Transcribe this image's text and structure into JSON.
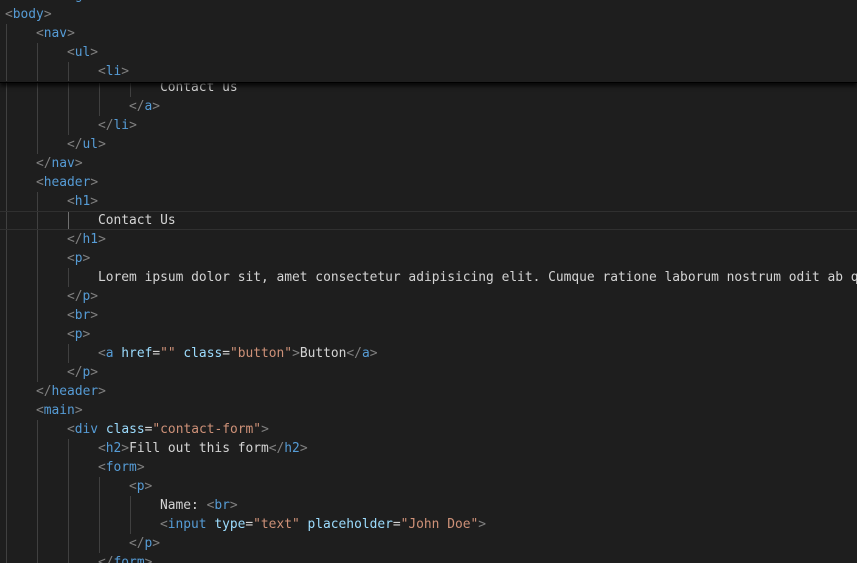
{
  "editor": {
    "sticky_lines": [
      {
        "indent": 0,
        "tokens": [
          {
            "t": "tag",
            "v": "<html lang=\"en\">"
          }
        ]
      },
      {
        "indent": 0,
        "tokens": [
          {
            "t": "brk",
            "v": "<"
          },
          {
            "t": "tag",
            "v": "body"
          },
          {
            "t": "brk",
            "v": ">"
          }
        ]
      },
      {
        "indent": 1,
        "tokens": [
          {
            "t": "brk",
            "v": "<"
          },
          {
            "t": "tag",
            "v": "nav"
          },
          {
            "t": "brk",
            "v": ">"
          }
        ]
      },
      {
        "indent": 2,
        "tokens": [
          {
            "t": "brk",
            "v": "<"
          },
          {
            "t": "tag",
            "v": "ul"
          },
          {
            "t": "brk",
            "v": ">"
          }
        ]
      },
      {
        "indent": 3,
        "tokens": [
          {
            "t": "brk",
            "v": "<"
          },
          {
            "t": "tag",
            "v": "li"
          },
          {
            "t": "brk",
            "v": ">"
          }
        ]
      }
    ],
    "lines": [
      {
        "indent": 5,
        "tokens": [
          {
            "t": "txt",
            "v": "Contact us"
          }
        ]
      },
      {
        "indent": 4,
        "tokens": [
          {
            "t": "brk",
            "v": "</"
          },
          {
            "t": "tag",
            "v": "a"
          },
          {
            "t": "brk",
            "v": ">"
          }
        ]
      },
      {
        "indent": 3,
        "tokens": [
          {
            "t": "brk",
            "v": "</"
          },
          {
            "t": "tag",
            "v": "li"
          },
          {
            "t": "brk",
            "v": ">"
          }
        ]
      },
      {
        "indent": 2,
        "tokens": [
          {
            "t": "brk",
            "v": "</"
          },
          {
            "t": "tag",
            "v": "ul"
          },
          {
            "t": "brk",
            "v": ">"
          }
        ]
      },
      {
        "indent": 1,
        "tokens": [
          {
            "t": "brk",
            "v": "</"
          },
          {
            "t": "tag",
            "v": "nav"
          },
          {
            "t": "brk",
            "v": ">"
          }
        ]
      },
      {
        "indent": 1,
        "tokens": [
          {
            "t": "brk",
            "v": "<"
          },
          {
            "t": "tag",
            "v": "header"
          },
          {
            "t": "brk",
            "v": ">"
          }
        ]
      },
      {
        "indent": 2,
        "tokens": [
          {
            "t": "brk",
            "v": "<"
          },
          {
            "t": "tag",
            "v": "h1"
          },
          {
            "t": "brk",
            "v": ">"
          }
        ]
      },
      {
        "indent": 3,
        "current": true,
        "tokens": [
          {
            "t": "txt",
            "v": "Contact Us"
          }
        ]
      },
      {
        "indent": 2,
        "tokens": [
          {
            "t": "brk",
            "v": "</"
          },
          {
            "t": "tag",
            "v": "h1"
          },
          {
            "t": "brk",
            "v": ">"
          }
        ]
      },
      {
        "indent": 2,
        "tokens": [
          {
            "t": "brk",
            "v": "<"
          },
          {
            "t": "tag",
            "v": "p"
          },
          {
            "t": "brk",
            "v": ">"
          }
        ]
      },
      {
        "indent": 3,
        "tokens": [
          {
            "t": "txt",
            "v": "Lorem ipsum dolor sit, amet consectetur adipisicing elit. Cumque ratione laborum nostrum odit ab qu"
          }
        ]
      },
      {
        "indent": 2,
        "tokens": [
          {
            "t": "brk",
            "v": "</"
          },
          {
            "t": "tag",
            "v": "p"
          },
          {
            "t": "brk",
            "v": ">"
          }
        ]
      },
      {
        "indent": 2,
        "tokens": [
          {
            "t": "brk",
            "v": "<"
          },
          {
            "t": "tag",
            "v": "br"
          },
          {
            "t": "brk",
            "v": ">"
          }
        ]
      },
      {
        "indent": 2,
        "tokens": [
          {
            "t": "brk",
            "v": "<"
          },
          {
            "t": "tag",
            "v": "p"
          },
          {
            "t": "brk",
            "v": ">"
          }
        ]
      },
      {
        "indent": 3,
        "tokens": [
          {
            "t": "brk",
            "v": "<"
          },
          {
            "t": "tag",
            "v": "a"
          },
          {
            "t": "txt",
            "v": " "
          },
          {
            "t": "attr",
            "v": "href"
          },
          {
            "t": "txt",
            "v": "="
          },
          {
            "t": "str",
            "v": "\"\""
          },
          {
            "t": "txt",
            "v": " "
          },
          {
            "t": "attr",
            "v": "class"
          },
          {
            "t": "txt",
            "v": "="
          },
          {
            "t": "str",
            "v": "\"button\""
          },
          {
            "t": "brk",
            "v": ">"
          },
          {
            "t": "txt",
            "v": "Button"
          },
          {
            "t": "brk",
            "v": "</"
          },
          {
            "t": "tag",
            "v": "a"
          },
          {
            "t": "brk",
            "v": ">"
          }
        ]
      },
      {
        "indent": 2,
        "tokens": [
          {
            "t": "brk",
            "v": "</"
          },
          {
            "t": "tag",
            "v": "p"
          },
          {
            "t": "brk",
            "v": ">"
          }
        ]
      },
      {
        "indent": 1,
        "tokens": [
          {
            "t": "brk",
            "v": "</"
          },
          {
            "t": "tag",
            "v": "header"
          },
          {
            "t": "brk",
            "v": ">"
          }
        ]
      },
      {
        "indent": 1,
        "tokens": [
          {
            "t": "brk",
            "v": "<"
          },
          {
            "t": "tag",
            "v": "main"
          },
          {
            "t": "brk",
            "v": ">"
          }
        ]
      },
      {
        "indent": 2,
        "tokens": [
          {
            "t": "brk",
            "v": "<"
          },
          {
            "t": "tag",
            "v": "div"
          },
          {
            "t": "txt",
            "v": " "
          },
          {
            "t": "attr",
            "v": "class"
          },
          {
            "t": "txt",
            "v": "="
          },
          {
            "t": "str",
            "v": "\"contact-form\""
          },
          {
            "t": "brk",
            "v": ">"
          }
        ]
      },
      {
        "indent": 3,
        "tokens": [
          {
            "t": "brk",
            "v": "<"
          },
          {
            "t": "tag",
            "v": "h2"
          },
          {
            "t": "brk",
            "v": ">"
          },
          {
            "t": "txt",
            "v": "Fill out this form"
          },
          {
            "t": "brk",
            "v": "</"
          },
          {
            "t": "tag",
            "v": "h2"
          },
          {
            "t": "brk",
            "v": ">"
          }
        ]
      },
      {
        "indent": 3,
        "tokens": [
          {
            "t": "brk",
            "v": "<"
          },
          {
            "t": "tag",
            "v": "form"
          },
          {
            "t": "brk",
            "v": ">"
          }
        ]
      },
      {
        "indent": 4,
        "tokens": [
          {
            "t": "brk",
            "v": "<"
          },
          {
            "t": "tag",
            "v": "p"
          },
          {
            "t": "brk",
            "v": ">"
          }
        ]
      },
      {
        "indent": 5,
        "tokens": [
          {
            "t": "txt",
            "v": "Name: "
          },
          {
            "t": "brk",
            "v": "<"
          },
          {
            "t": "tag",
            "v": "br"
          },
          {
            "t": "brk",
            "v": ">"
          }
        ]
      },
      {
        "indent": 5,
        "tokens": [
          {
            "t": "brk",
            "v": "<"
          },
          {
            "t": "tag",
            "v": "input"
          },
          {
            "t": "txt",
            "v": " "
          },
          {
            "t": "attr",
            "v": "type"
          },
          {
            "t": "txt",
            "v": "="
          },
          {
            "t": "str",
            "v": "\"text\""
          },
          {
            "t": "txt",
            "v": " "
          },
          {
            "t": "attr",
            "v": "placeholder"
          },
          {
            "t": "txt",
            "v": "="
          },
          {
            "t": "str",
            "v": "\"John Doe\""
          },
          {
            "t": "brk",
            "v": ">"
          }
        ]
      },
      {
        "indent": 4,
        "tokens": [
          {
            "t": "brk",
            "v": "</"
          },
          {
            "t": "tag",
            "v": "p"
          },
          {
            "t": "brk",
            "v": ">"
          }
        ]
      },
      {
        "indent": 3,
        "tokens": [
          {
            "t": "brk",
            "v": "</"
          },
          {
            "t": "tag",
            "v": "form"
          },
          {
            "t": "brk",
            "v": ">"
          }
        ]
      }
    ]
  }
}
